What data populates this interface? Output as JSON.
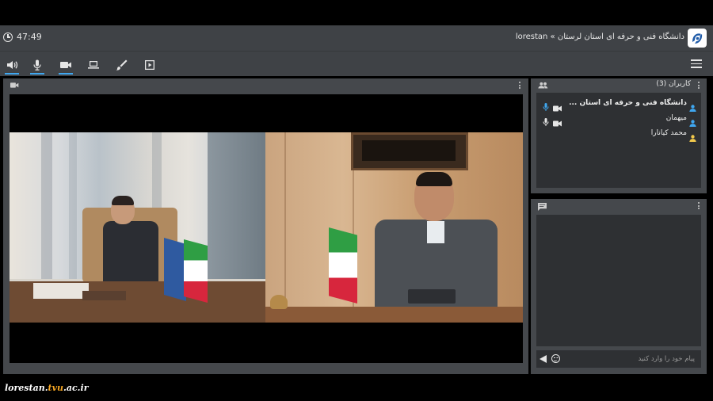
{
  "session": {
    "timer": "47:49",
    "title": "دانشگاه فنی و حرفه ای استان لرستان » lorestan"
  },
  "toolbar": {
    "items": [
      {
        "name": "speaker",
        "active": true
      },
      {
        "name": "microphone",
        "active": true
      },
      {
        "name": "camera",
        "active": true
      },
      {
        "name": "screen-share",
        "active": false
      },
      {
        "name": "whiteboard",
        "active": false
      },
      {
        "name": "presentation",
        "active": false
      }
    ]
  },
  "users": {
    "header": "کاربران (3)",
    "list": [
      {
        "name": "دانشگاه فنی و حرفه ای استان ...",
        "bold": true,
        "mic": true,
        "cam": true,
        "role_color": "#3fa7f0"
      },
      {
        "name": "میهمان",
        "bold": false,
        "mic": true,
        "cam": true,
        "role_color": "#3fa7f0"
      },
      {
        "name": "محمد کیانارا",
        "bold": false,
        "mic": false,
        "cam": false,
        "role_color": "#f2c94c"
      }
    ]
  },
  "chat": {
    "placeholder": "پیام خود را وارد کنید"
  },
  "watermark": {
    "prefix": "lorestan.",
    "accent": "tvu",
    "suffix": ".ac.ir"
  },
  "colors": {
    "accent": "#3fa7f0",
    "panel": "#45484c",
    "inner": "#2e3033",
    "bar": "#3f4246"
  }
}
